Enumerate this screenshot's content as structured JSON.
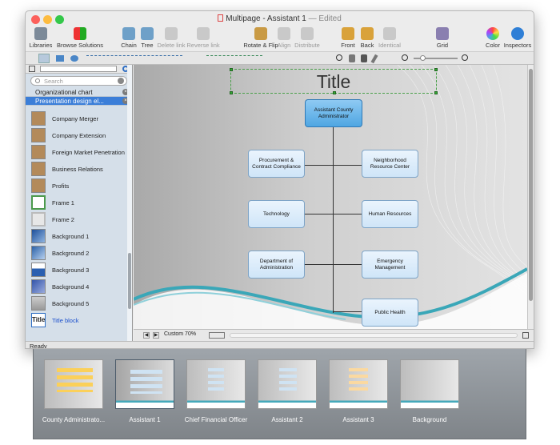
{
  "window": {
    "doc_title": "Multipage - Assistant 1",
    "edited": "— Edited"
  },
  "toolbar": [
    {
      "name": "libraries",
      "label": "Libraries",
      "icon": "libraries-icon"
    },
    {
      "name": "browse-solutions",
      "label": "Browse Solutions",
      "icon": "browse-solutions-icon"
    },
    {
      "name": "chain",
      "label": "Chain",
      "icon": "chain-icon"
    },
    {
      "name": "tree",
      "label": "Tree",
      "icon": "tree-icon"
    },
    {
      "name": "delete-link",
      "label": "Delete link",
      "icon": "delete-link-icon"
    },
    {
      "name": "reverse-link",
      "label": "Reverse link",
      "icon": "reverse-link-icon"
    },
    {
      "name": "rotate-flip",
      "label": "Rotate & Flip",
      "icon": "rotate-flip-icon"
    },
    {
      "name": "align",
      "label": "Align",
      "icon": "align-icon"
    },
    {
      "name": "distribute",
      "label": "Distribute",
      "icon": "distribute-icon"
    },
    {
      "name": "front",
      "label": "Front",
      "icon": "front-icon"
    },
    {
      "name": "back",
      "label": "Back",
      "icon": "back-icon"
    },
    {
      "name": "identical",
      "label": "Identical",
      "icon": "identical-icon"
    },
    {
      "name": "grid",
      "label": "Grid",
      "icon": "grid-icon"
    },
    {
      "name": "color",
      "label": "Color",
      "icon": "color-icon"
    },
    {
      "name": "inspectors",
      "label": "Inspectors",
      "icon": "inspectors-icon"
    }
  ],
  "sidebar": {
    "search_placeholder": "Search",
    "libraries": [
      "Organizational chart",
      "Presentation design el..."
    ],
    "items": [
      "Company Merger",
      "Company Extension",
      "Foreign Market Penetration",
      "Business Relations",
      "Profits",
      "Frame 1",
      "Frame 2",
      "Background 1",
      "Background 2",
      "Background 3",
      "Background 4",
      "Background 5",
      "Title block"
    ],
    "title_thumb": "Title"
  },
  "status": {
    "text": "Ready",
    "zoom": "Custom 70%"
  },
  "canvas": {
    "title": "Title",
    "org": {
      "top": "Assistant County Administrator",
      "left": [
        "Procurement & Contract Compliance",
        "Technology",
        "Department of Administration"
      ],
      "right": [
        "Neighborhood Resource Center",
        "Human Resources",
        "Emergency Management",
        "Public Health"
      ]
    }
  },
  "pages": [
    "County Administrato...",
    "Assistant 1",
    "Chief Financial Officer",
    "Assistant 2",
    "Assistant 3",
    "Background"
  ],
  "colors": {
    "accent": "#3b7ed8",
    "top_node": "#4fa6e2",
    "node": "#cfe5f8",
    "wave": "#3aa7b8"
  }
}
